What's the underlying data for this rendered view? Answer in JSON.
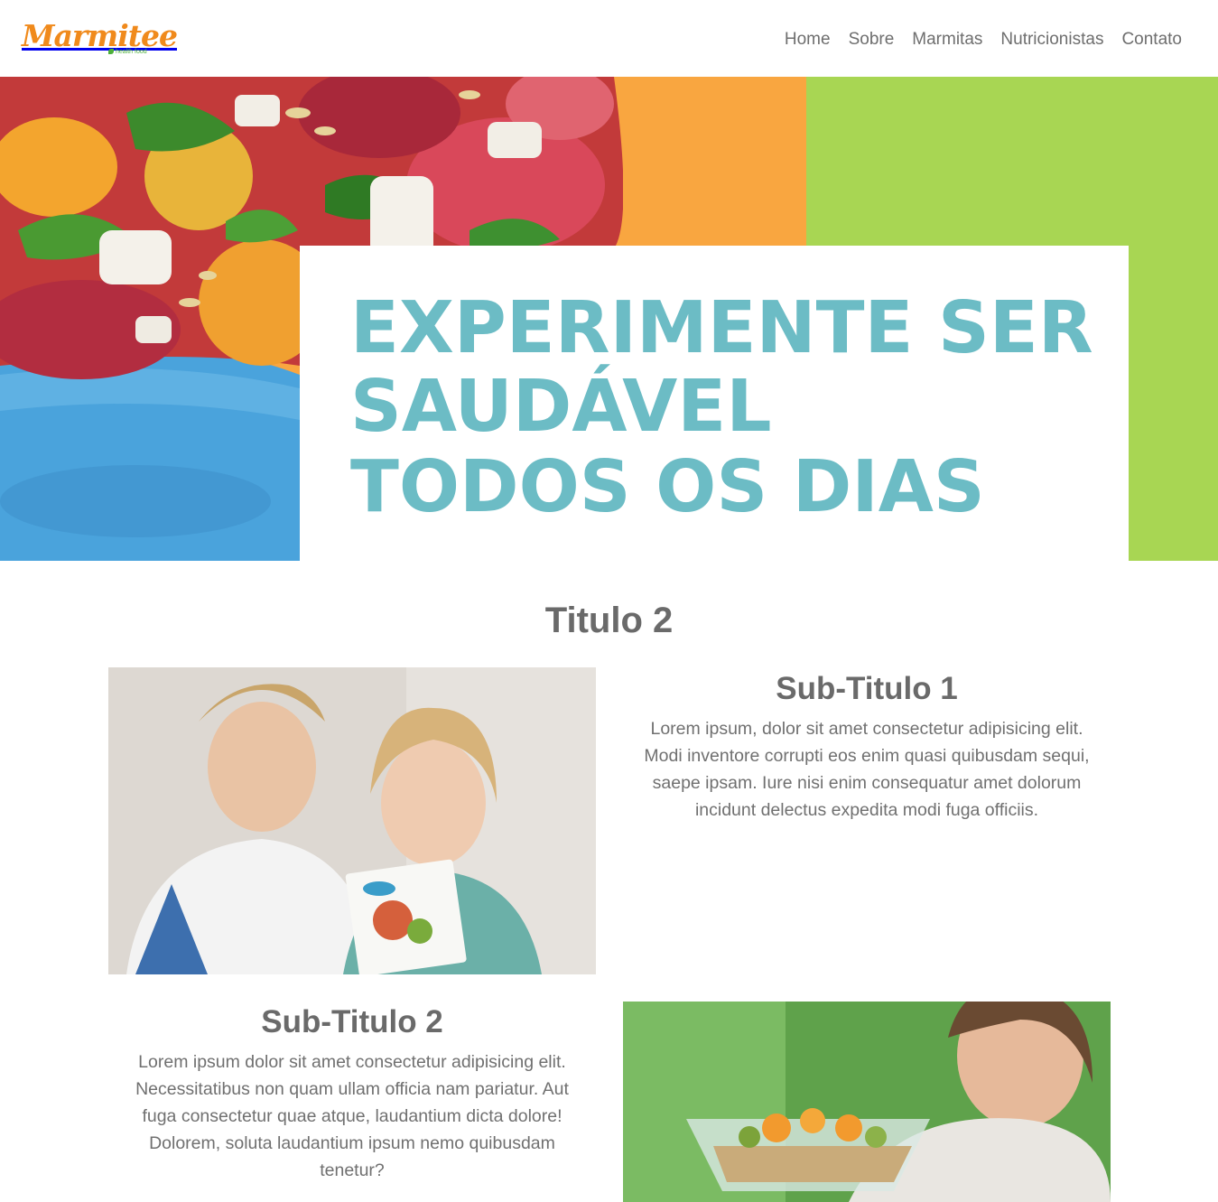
{
  "brand": {
    "name": "Marmitee",
    "tagline": "health food",
    "primary_color": "#f08a1c",
    "leaf_color": "#4caf3a"
  },
  "nav": {
    "items": [
      {
        "label": "Home"
      },
      {
        "label": "Sobre"
      },
      {
        "label": "Marmitas"
      },
      {
        "label": "Nutricionistas"
      },
      {
        "label": "Contato"
      }
    ]
  },
  "hero": {
    "line1": "EXPERIMENTE SER",
    "line2": "SAUDÁVEL",
    "line3": "TODOS OS DIAS",
    "text_color": "#6cbcc5",
    "orange": "#f9a640",
    "green": "#a8d653",
    "image": "salad-bowl-photo"
  },
  "main": {
    "title": "Titulo 2",
    "sections": [
      {
        "subtitle": "Sub-Titulo 1",
        "text": "Lorem ipsum, dolor sit amet consectetur adipisicing elit. Modi inventore corrupti eos enim quasi quibusdam sequi, saepe ipsam. Iure nisi enim consequatur amet dolorum incidunt delectus expedita modi fuga officiis.",
        "image": "nutritionist-consultation-photo"
      },
      {
        "subtitle": "Sub-Titulo 2",
        "text": "Lorem ipsum dolor sit amet consectetur adipisicing elit. Necessitatibus non quam ullam officia nam pariatur. Aut fuga consectetur quae atque, laudantium dicta dolore! Dolorem, soluta laudantium ipsum nemo quibusdam tenetur?",
        "image": "woman-holding-fruit-bowl-photo"
      }
    ]
  }
}
